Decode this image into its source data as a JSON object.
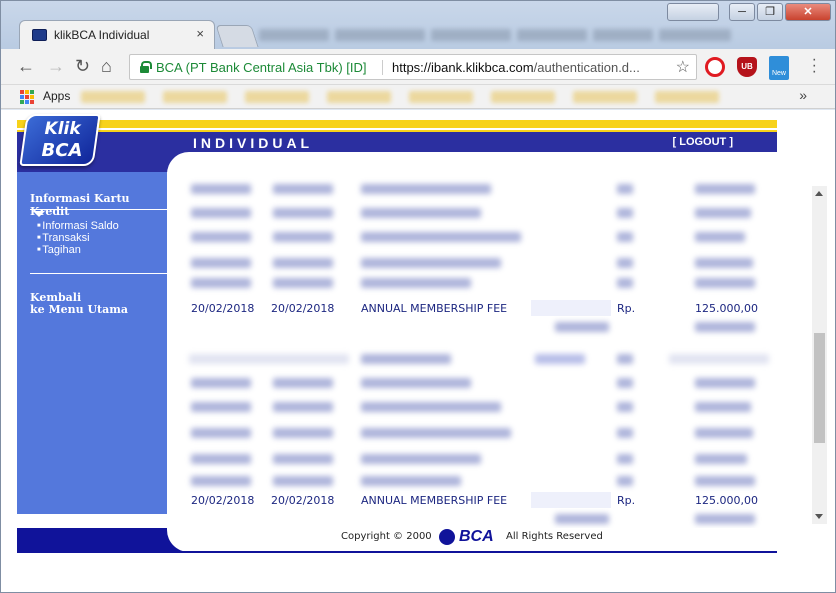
{
  "browser": {
    "tab_title": "klikBCA Individual",
    "tab_close": "×",
    "ev_label": "BCA (PT Bank Central Asia Tbk) [ID]",
    "url_host": "https://ibank.klikbca.com",
    "url_path": "/authentication.d...",
    "bookmark_apps": "Apps",
    "ext_new_badge": "New",
    "ext_ub": "UB",
    "win_close": "✕",
    "win_min": "─",
    "win_max": "❐"
  },
  "header": {
    "section": "INDIVIDUAL",
    "logout": "[ LOGOUT ]",
    "logo_line1": "Klik",
    "logo_line2": "BCA"
  },
  "sidebar": {
    "heading": "Informasi Kartu Kredit",
    "items": [
      {
        "label": "Informasi Saldo"
      },
      {
        "label": "Transaksi"
      },
      {
        "label": "Tagihan"
      }
    ],
    "back_line1": "Kembali",
    "back_line2": "ke Menu Utama"
  },
  "transactions": [
    {
      "trans_date": "20/02/2018",
      "post_date": "20/02/2018",
      "description": "ANNUAL MEMBERSHIP FEE",
      "currency": "Rp.",
      "amount": "125.000,00"
    },
    {
      "trans_date": "20/02/2018",
      "post_date": "20/02/2018",
      "description": "ANNUAL MEMBERSHIP FEE",
      "currency": "Rp.",
      "amount": "125.000,00"
    }
  ],
  "footer": {
    "copyright": "Copyright © 2000",
    "brand": "BCA",
    "rights": "All Rights Reserved"
  },
  "colors": {
    "bca_blue": "#2b2fa0",
    "sidebar_blue": "#5478dc",
    "bca_yellow": "#f7d21a",
    "ev_green": "#1c8a37"
  }
}
